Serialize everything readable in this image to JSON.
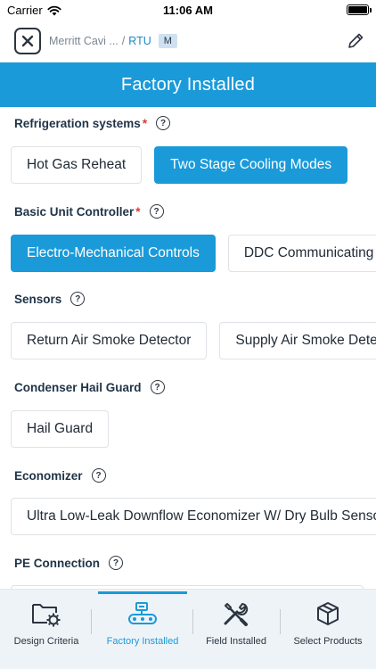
{
  "status_bar": {
    "carrier": "Carrier",
    "time": "11:06 AM"
  },
  "nav": {
    "breadcrumb_project": "Merritt Cavi ...",
    "breadcrumb_separator": "/",
    "breadcrumb_unit": "RTU",
    "badge": "M"
  },
  "header": {
    "title": "Factory Installed"
  },
  "sections": {
    "refrigeration": {
      "label": "Refrigeration systems",
      "required": "*",
      "options": [
        "Hot Gas Reheat",
        "Two Stage Cooling Modes"
      ]
    },
    "controller": {
      "label": "Basic Unit Controller",
      "required": "*",
      "options": [
        "Electro-Mechanical Controls",
        "DDC Communicating Controls"
      ]
    },
    "sensors": {
      "label": "Sensors",
      "options": [
        "Return Air Smoke Detector",
        "Supply Air Smoke Detector"
      ]
    },
    "hail_guard": {
      "label": "Condenser Hail Guard",
      "options": [
        "Hail Guard"
      ]
    },
    "economizer": {
      "label": "Economizer",
      "options": [
        "Ultra Low-Leak Downflow Economizer W/ Dry Bulb Sensor"
      ]
    },
    "pe_connection": {
      "label": "PE Connection",
      "options": [
        ""
      ]
    }
  },
  "tabs": [
    {
      "label": "Design Criteria",
      "icon": "folder-gear-icon"
    },
    {
      "label": "Factory Installed",
      "icon": "conveyor-icon"
    },
    {
      "label": "Field Installed",
      "icon": "tools-icon"
    },
    {
      "label": "Select Products",
      "icon": "box-icon"
    }
  ],
  "colors": {
    "accent": "#1a9ad9",
    "required": "#d93a3a",
    "breadcrumb_link": "#1e88c8"
  }
}
